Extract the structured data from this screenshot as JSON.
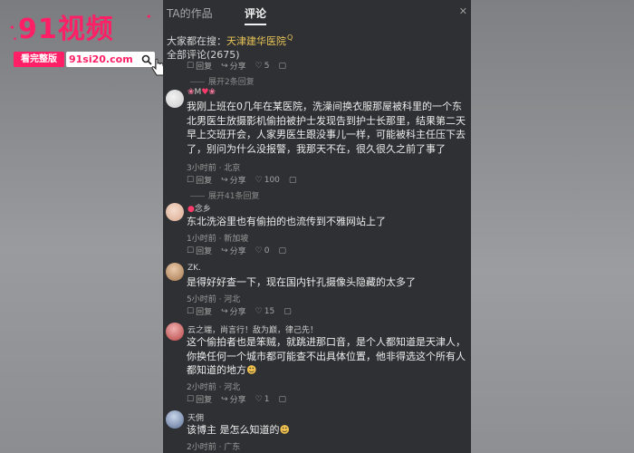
{
  "logo": {
    "number": "91",
    "title": "视频",
    "tag": "看完整版",
    "url": "91si20.com"
  },
  "tabs": {
    "ta_works": "TA的作品",
    "comments": "评论"
  },
  "close_icon": "✕",
  "search": {
    "prefix": "大家都在搜：",
    "link": "天津建华医院",
    "mark": "Q"
  },
  "all_comments": "全部评论(2675)",
  "labels": {
    "reply": "回复",
    "share": "分享"
  },
  "top_actions": {
    "likes": "5"
  },
  "expand_first": "展开2条回复",
  "comments": [
    {
      "name": "M",
      "text": "我刚上班在0几年在某医院，洗澡间换衣服那屋被科里的一个东北男医生放摄影机偷拍被护士发现告到护士长那里，结果第二天早上交班开会，人家男医生跟没事儿一样，可能被科主任压下去了，别问为什么没报警，我那天不在，很久很久之前了事了",
      "meta": "3小时前 · 北京",
      "likes": "100"
    },
    {
      "name": "念乡",
      "text": "东北洗浴里也有偷拍的也流传到不雅网站上了",
      "meta": "1小时前 · 新加坡",
      "likes": "0"
    },
    {
      "name": "ZK.",
      "text": "是得好好查一下，现在国内针孔摄像头隐藏的太多了",
      "meta": "5小时前 · 河北",
      "likes": "15"
    },
    {
      "name": "云之端，尚言行！敌为巅，律己先！",
      "text": "这个偷拍者也是笨贼，就跳进那口音，是个人都知道是天津人，你换任何一个城市都可能查不出具体位置，他非得选这个所有人都知道的地方",
      "meta": "2小时前 · 河北",
      "likes": "1"
    },
    {
      "name": "天佣",
      "text": "该博主 是怎么知道的",
      "meta": "2小时前 · 广东"
    }
  ],
  "expand_second": "展开41条回复",
  "colors": {
    "accent": "#e7c357",
    "brand": "#ff1f66",
    "panel": "#2f3033"
  }
}
